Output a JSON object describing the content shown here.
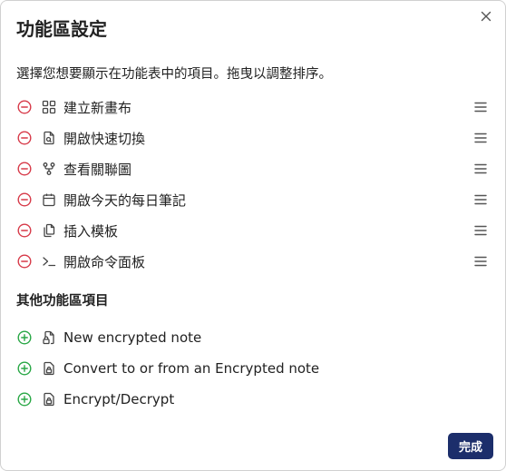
{
  "dialog": {
    "title": "功能區設定",
    "description": "選擇您想要顯示在功能表中的項目。拖曳以調整排序。",
    "close_icon": "close-icon"
  },
  "enabled_items": [
    {
      "label": "建立新畫布",
      "icon": "layout-grid-icon"
    },
    {
      "label": "開啟快速切換",
      "icon": "file-search-icon"
    },
    {
      "label": "查看關聯圖",
      "icon": "git-fork-icon"
    },
    {
      "label": "開啟今天的每日筆記",
      "icon": "calendar-icon"
    },
    {
      "label": "插入模板",
      "icon": "files-icon"
    },
    {
      "label": "開啟命令面板",
      "icon": "terminal-icon"
    }
  ],
  "other_section": {
    "title": "其他功能區項目",
    "items": [
      {
        "label": "New encrypted note",
        "icon": "file-lock-icon"
      },
      {
        "label": "Convert to or from an Encrypted note",
        "icon": "lock-file-icon"
      },
      {
        "label": "Encrypt/Decrypt",
        "icon": "lock-file-icon"
      }
    ]
  },
  "footer": {
    "done_label": "完成"
  },
  "colors": {
    "remove": "#d73a49",
    "add": "#28a745",
    "button": "#1c2e6b"
  }
}
